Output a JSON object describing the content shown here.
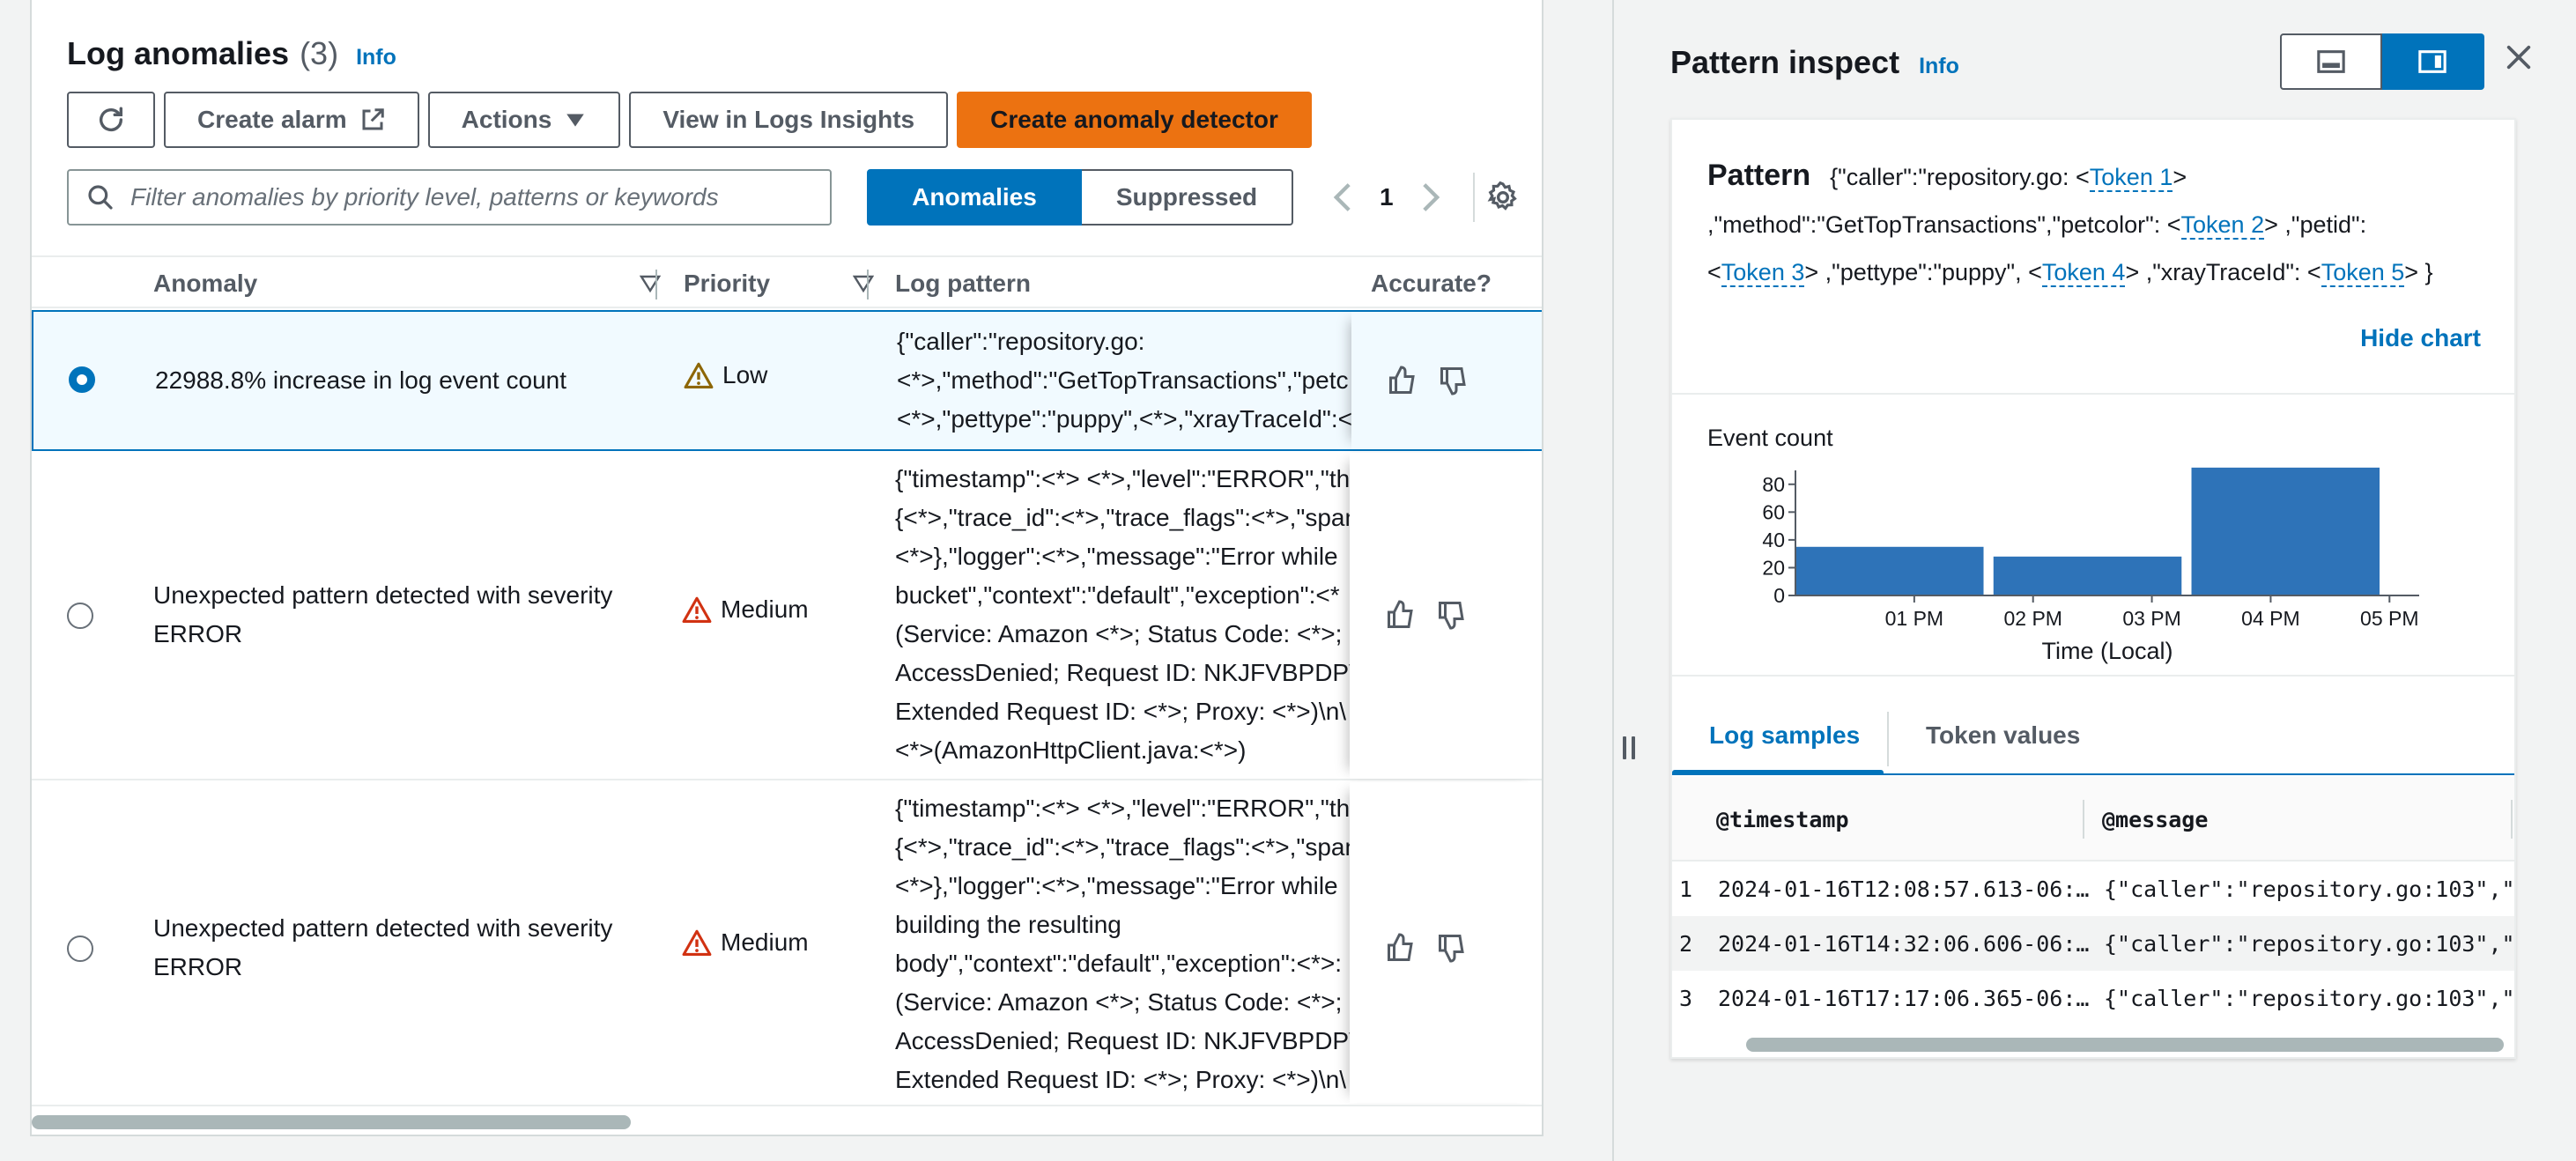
{
  "left": {
    "title": "Log anomalies",
    "count": "(3)",
    "info": "Info",
    "toolbar": {
      "create_alarm": "Create alarm",
      "actions": "Actions",
      "view_insights": "View in Logs Insights",
      "create_detector": "Create anomaly detector"
    },
    "search_placeholder": "Filter anomalies by priority level, patterns or keywords",
    "segments": {
      "anomalies": "Anomalies",
      "suppressed": "Suppressed"
    },
    "page": "1",
    "columns": {
      "anomaly": "Anomaly",
      "priority": "Priority",
      "log_pattern": "Log pattern",
      "accurate": "Accurate?"
    },
    "rows": [
      {
        "selected": true,
        "anomaly": "22988.8% increase in log event count",
        "priority": "Low",
        "pattern": "{\"caller\":\"repository.go:\n<*>,\"method\":\"GetTopTransactions\",\"petc\n<*>,\"pettype\":\"puppy\",<*>,\"xrayTraceId\":<"
      },
      {
        "selected": false,
        "anomaly": "Unexpected pattern detected with severity ERROR",
        "priority": "Medium",
        "pattern": "{\"timestamp\":<*> <*>,\"level\":\"ERROR\",\"th\n{<*>,\"trace_id\":<*>,\"trace_flags\":<*>,\"span\n<*>},\"logger\":<*>,\"message\":\"Error while \nbucket\",\"context\":\"default\",\"exception\":<*\n(Service: Amazon <*>; Status Code: <*>; E\nAccessDenied; Request ID: NKJFVBPDPW\nExtended Request ID: <*>; Proxy: <*>)\\n\\\n<*>(AmazonHttpClient.java:<*>)"
      },
      {
        "selected": false,
        "anomaly": "Unexpected pattern detected with severity ERROR",
        "priority": "Medium",
        "pattern": "{\"timestamp\":<*> <*>,\"level\":\"ERROR\",\"th\n{<*>,\"trace_id\":<*>,\"trace_flags\":<*>,\"span\n<*>},\"logger\":<*>,\"message\":\"Error while \nbuilding the resulting\nbody\",\"context\":\"default\",\"exception\":<*>:\n(Service: Amazon <*>; Status Code: <*>; E\nAccessDenied; Request ID: NKJFVBPDPW\nExtended Request ID: <*>; Proxy: <*>)\\n\\"
      }
    ]
  },
  "right": {
    "title": "Pattern inspect",
    "info": "Info",
    "pattern_label": "Pattern",
    "pattern_parts": {
      "p1": "{\"caller\":\"repository.go: <",
      "t1": "Token 1",
      "p2": ">\n,\"method\":\"GetTopTransactions\",\"petcolor\": <",
      "t2": "Token 2",
      "p3": "> ,\"petid\":\n<",
      "t3": "Token 3",
      "p4": "> ,\"pettype\":\"puppy\", <",
      "t4": "Token 4",
      "p5": "> ,\"xrayTraceId\": <",
      "t5": "Token 5",
      "p6": "> }"
    },
    "hide_chart": "Hide chart",
    "tabs": {
      "log_samples": "Log samples",
      "token_values": "Token values"
    },
    "sample_columns": {
      "timestamp": "@timestamp",
      "message": "@message"
    },
    "samples": [
      {
        "n": "1",
        "timestamp": "2024-01-16T12:08:57.613-06:…",
        "message": "{\"caller\":\"repository.go:103\",\"…"
      },
      {
        "n": "2",
        "timestamp": "2024-01-16T14:32:06.606-06:…",
        "message": "{\"caller\":\"repository.go:103\",\"…"
      },
      {
        "n": "3",
        "timestamp": "2024-01-16T17:17:06.365-06:…",
        "message": "{\"caller\":\"repository.go:103\",\"…"
      }
    ]
  },
  "chart_data": {
    "type": "bar",
    "title": "Event count",
    "xlabel": "Time (Local)",
    "ylabel": "",
    "yticks": [
      0,
      20,
      40,
      60,
      80
    ],
    "ylim": [
      0,
      90
    ],
    "xticks": [
      "01 PM",
      "02 PM",
      "03 PM",
      "04 PM",
      "05 PM"
    ],
    "x_range": [
      "12:00",
      "17:15"
    ],
    "bars": [
      {
        "start": "12:00",
        "end": "13:35",
        "value": 35
      },
      {
        "start": "13:40",
        "end": "15:15",
        "value": 28
      },
      {
        "start": "15:20",
        "end": "16:55",
        "value": 92
      }
    ],
    "colors": {
      "bar": "#2e73b8",
      "axis": "#545b64"
    }
  },
  "colors": {
    "primary": "#0073bb",
    "accent": "#ec7211",
    "warning": "#8d6605"
  },
  "icons": {
    "refresh": "refresh-icon",
    "external": "external-link-icon",
    "caret": "caret-down-icon",
    "search": "search-icon",
    "gear": "gear-icon",
    "warning": "warning-icon",
    "thumbs_up": "thumbs-up-icon",
    "thumbs_down": "thumbs-down-icon",
    "close": "close-icon"
  }
}
